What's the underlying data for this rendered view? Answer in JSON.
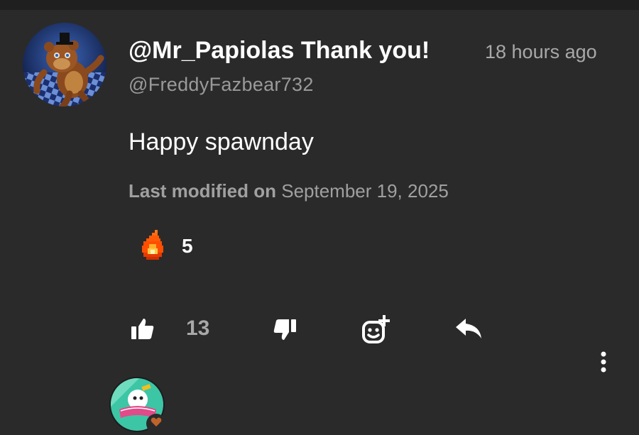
{
  "comment": {
    "title": "@Mr_Papiolas Thank you!",
    "timestamp": "18 hours ago",
    "handle": "@FreddyFazbear732",
    "body": "Happy spawnday",
    "modified_label": "Last modified on",
    "modified_date": "September 19, 2025"
  },
  "reaction": {
    "icon": "fire-icon",
    "count": "5"
  },
  "actions": {
    "like_icon": "thumbs-up-icon",
    "like_count": "13",
    "dislike_icon": "thumbs-down-icon",
    "add_reaction_icon": "add-reaction-icon",
    "reply_icon": "reply-icon",
    "more_icon": "more-vertical-icon"
  },
  "reply_preview": {
    "avatar_icon": "avatar",
    "badge_icon": "heart-icon"
  },
  "colors": {
    "background": "#2a2a2b",
    "secondary_text": "#a0a0a0",
    "primary_text": "#ffffff"
  }
}
